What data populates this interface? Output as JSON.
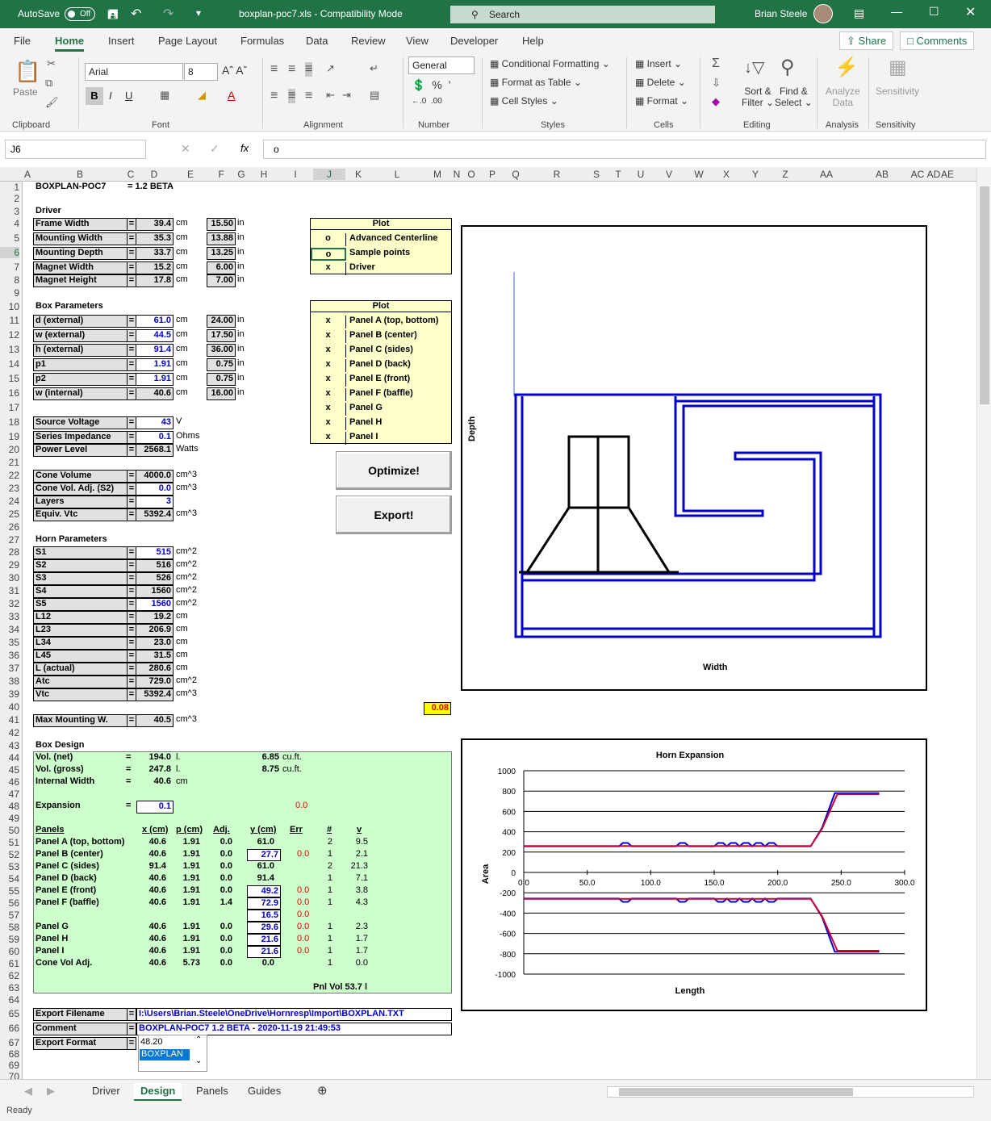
{
  "titlebar": {
    "autosave": "AutoSave",
    "toggle": "Off",
    "filename": "boxplan-poc7.xls  -  Compatibility Mode",
    "search": "Search",
    "user": "Brian Steele"
  },
  "menu": [
    "File",
    "Home",
    "Insert",
    "Page Layout",
    "Formulas",
    "Data",
    "Review",
    "View",
    "Developer",
    "Help"
  ],
  "share": "Share",
  "comments": "Comments",
  "ribbon": {
    "paste": "Paste",
    "font_name": "Arial",
    "font_size": "8",
    "number_format": "General",
    "cond_format": "Conditional Formatting",
    "format_table": "Format as Table",
    "cell_styles": "Cell Styles",
    "insert": "Insert",
    "delete": "Delete",
    "format": "Format",
    "sort1": "Sort &",
    "sort2": "Filter",
    "find1": "Find &",
    "find2": "Select",
    "analyze1": "Analyze",
    "analyze2": "Data",
    "sens": "Sensitivity",
    "groups": {
      "clipboard": "Clipboard",
      "font": "Font",
      "alignment": "Alignment",
      "number": "Number",
      "styles": "Styles",
      "cells": "Cells",
      "editing": "Editing",
      "analysis": "Analysis",
      "sensitivity": "Sensitivity"
    }
  },
  "formula": {
    "cell": "J6",
    "content": "o"
  },
  "columns": [
    "A",
    "B",
    "C",
    "D",
    "E",
    "F",
    "G",
    "H",
    "I",
    "J",
    "K",
    "L",
    "M",
    "N",
    "O",
    "P",
    "Q",
    "R",
    "S",
    "T",
    "U",
    "V",
    "W",
    "X",
    "Y",
    "Z",
    "AA",
    "AB",
    "AC",
    "AD",
    "AE"
  ],
  "sheet": {
    "title": "BOXPLAN-POC7",
    "version": "=  1.2 BETA",
    "driver_hdr": "Driver",
    "driver": [
      {
        "label": "Frame Width",
        "eq": "=",
        "val": "39.4",
        "unit": "cm",
        "in": "15.50",
        "iu": "in"
      },
      {
        "label": "Mounting Width",
        "eq": "=",
        "val": "35.3",
        "unit": "cm",
        "in": "13.88",
        "iu": "in"
      },
      {
        "label": "Mounting Depth",
        "eq": "=",
        "val": "33.7",
        "unit": "cm",
        "in": "13.25",
        "iu": "in"
      },
      {
        "label": "Magnet Width",
        "eq": "=",
        "val": "15.2",
        "unit": "cm",
        "in": "6.00",
        "iu": "in"
      },
      {
        "label": "Magnet Height",
        "eq": "=",
        "val": "17.8",
        "unit": "cm",
        "in": "7.00",
        "iu": "in"
      }
    ],
    "box_hdr": "Box Parameters",
    "box": [
      {
        "label": "d (external)",
        "eq": "=",
        "val": "61.0",
        "unit": "cm",
        "in": "24.00",
        "iu": "in"
      },
      {
        "label": "w (external)",
        "eq": "=",
        "val": "44.5",
        "unit": "cm",
        "in": "17.50",
        "iu": "in"
      },
      {
        "label": "h (external)",
        "eq": "=",
        "val": "91.4",
        "unit": "cm",
        "in": "36.00",
        "iu": "in"
      },
      {
        "label": "p1",
        "eq": "=",
        "val": "1.91",
        "unit": "cm",
        "in": "0.75",
        "iu": "in"
      },
      {
        "label": "p2",
        "eq": "=",
        "val": "1.91",
        "unit": "cm",
        "in": "0.75",
        "iu": "in"
      },
      {
        "label": "w (internal)",
        "eq": "=",
        "val": "40.6",
        "unit": "cm",
        "in": "16.00",
        "iu": "in"
      }
    ],
    "power": [
      {
        "label": "Source Voltage",
        "eq": "=",
        "val": "43",
        "unit": "V"
      },
      {
        "label": "Series Impedance",
        "eq": "=",
        "val": "0.1",
        "unit": "Ohms"
      },
      {
        "label": "Power Level",
        "eq": "=",
        "val": "2568.1",
        "unit": "Watts"
      }
    ],
    "cone": [
      {
        "label": "Cone Volume",
        "eq": "=",
        "val": "4000.0",
        "unit": "cm^3"
      },
      {
        "label": "Cone Vol. Adj. (S2)",
        "eq": "=",
        "val": "0.0",
        "unit": "cm^3"
      },
      {
        "label": "Layers",
        "eq": "=",
        "val": "3",
        "unit": ""
      },
      {
        "label": "Equiv. Vtc",
        "eq": "=",
        "val": "5392.4",
        "unit": "cm^3"
      }
    ],
    "horn_hdr": "Horn Parameters",
    "horn": [
      {
        "label": "S1",
        "eq": "=",
        "val": "515",
        "unit": "cm^2"
      },
      {
        "label": "S2",
        "eq": "=",
        "val": "516",
        "unit": "cm^2"
      },
      {
        "label": "S3",
        "eq": "=",
        "val": "526",
        "unit": "cm^2"
      },
      {
        "label": "S4",
        "eq": "=",
        "val": "1560",
        "unit": "cm^2"
      },
      {
        "label": "S5",
        "eq": "=",
        "val": "1560",
        "unit": "cm^2"
      },
      {
        "label": "L12",
        "eq": "=",
        "val": "19.2",
        "unit": "cm"
      },
      {
        "label": "L23",
        "eq": "=",
        "val": "206.9",
        "unit": "cm"
      },
      {
        "label": "L34",
        "eq": "=",
        "val": "23.0",
        "unit": "cm"
      },
      {
        "label": "L45",
        "eq": "=",
        "val": "31.5",
        "unit": "cm"
      },
      {
        "label": "L (actual)",
        "eq": "=",
        "val": "280.6",
        "unit": "cm"
      },
      {
        "label": "Atc",
        "eq": "=",
        "val": "729.0",
        "unit": "cm^2"
      },
      {
        "label": "Vtc",
        "eq": "=",
        "val": "5392.4",
        "unit": "cm^3"
      }
    ],
    "maxmount": {
      "label": "Max Mounting W.",
      "eq": "=",
      "val": "40.5",
      "unit": "cm^3"
    },
    "plot1_hdr": "Plot",
    "plot1": [
      {
        "mark": "o",
        "label": "Advanced Centerline"
      },
      {
        "mark": "o",
        "label": "Sample points"
      },
      {
        "mark": "x",
        "label": "Driver"
      }
    ],
    "plot2_hdr": "Plot",
    "plot2": [
      {
        "mark": "x",
        "label": "Panel A (top, bottom)"
      },
      {
        "mark": "x",
        "label": "Panel B (center)"
      },
      {
        "mark": "x",
        "label": "Panel C (sides)"
      },
      {
        "mark": "x",
        "label": "Panel D (back)"
      },
      {
        "mark": "x",
        "label": "Panel E (front)"
      },
      {
        "mark": "x",
        "label": "Panel F (baffle)"
      },
      {
        "mark": "x",
        "label": "Panel G"
      },
      {
        "mark": "x",
        "label": "Panel H"
      },
      {
        "mark": "x",
        "label": "Panel I"
      }
    ],
    "optimize": "Optimize!",
    "export": "Export!",
    "m40": "0.08",
    "design_hdr": "Box Design",
    "vol_net": {
      "label": "Vol. (net)",
      "eq": "=",
      "val": "194.0",
      "unit": "l.",
      "cf": "6.85",
      "cfu": "cu.ft."
    },
    "vol_gross": {
      "label": "Vol. (gross)",
      "eq": "=",
      "val": "247.8",
      "unit": "l.",
      "cf": "8.75",
      "cfu": "cu.ft."
    },
    "internal": {
      "label": "Internal Width",
      "eq": "=",
      "val": "40.6",
      "unit": "cm"
    },
    "expansion": {
      "label": "Expansion",
      "eq": "=",
      "val": "0.1",
      "err": "0.0"
    },
    "panel_cols": [
      "Panels",
      "x (cm)",
      "p (cm)",
      "Adj.",
      "y (cm)",
      "Err",
      "#",
      "v"
    ],
    "panels": [
      {
        "name": "Panel A (top, bottom)",
        "x": "40.6",
        "p": "1.91",
        "adj": "0.0",
        "y": "61.0",
        "err": "",
        "n": "2",
        "v": "9.5",
        "yin": false
      },
      {
        "name": "Panel B (center)",
        "x": "40.6",
        "p": "1.91",
        "adj": "0.0",
        "y": "27.7",
        "err": "0.0",
        "n": "1",
        "v": "2.1",
        "yin": true
      },
      {
        "name": "Panel C (sides)",
        "x": "91.4",
        "p": "1.91",
        "adj": "0.0",
        "y": "61.0",
        "err": "",
        "n": "2",
        "v": "21.3",
        "yin": false
      },
      {
        "name": "Panel D (back)",
        "x": "40.6",
        "p": "1.91",
        "adj": "0.0",
        "y": "91.4",
        "err": "",
        "n": "1",
        "v": "7.1",
        "yin": false
      },
      {
        "name": "Panel E (front)",
        "x": "40.6",
        "p": "1.91",
        "adj": "0.0",
        "y": "49.2",
        "err": "0.0",
        "n": "1",
        "v": "3.8",
        "yin": true
      },
      {
        "name": "Panel F (baffle)",
        "x": "40.6",
        "p": "1.91",
        "adj": "1.4",
        "y": "72.9",
        "err": "0.0",
        "n": "1",
        "v": "4.3",
        "yin": true
      },
      {
        "name": "",
        "x": "",
        "p": "",
        "adj": "",
        "y": "16.5",
        "err": "0.0",
        "n": "",
        "v": "",
        "yin": true
      },
      {
        "name": "Panel G",
        "x": "40.6",
        "p": "1.91",
        "adj": "0.0",
        "y": "29.6",
        "err": "0.0",
        "n": "1",
        "v": "2.3",
        "yin": true
      },
      {
        "name": "Panel H",
        "x": "40.6",
        "p": "1.91",
        "adj": "0.0",
        "y": "21.6",
        "err": "0.0",
        "n": "1",
        "v": "1.7",
        "yin": true
      },
      {
        "name": "Panel I",
        "x": "40.6",
        "p": "1.91",
        "adj": "0.0",
        "y": "21.6",
        "err": "0.0",
        "n": "1",
        "v": "1.7",
        "yin": true
      },
      {
        "name": "Cone Vol Adj.",
        "x": "40.6",
        "p": "5.73",
        "adj": "0.0",
        "y": "0.0",
        "err": "",
        "n": "1",
        "v": "0.0",
        "yin": false
      }
    ],
    "pnlvol": "Pnl Vol   53.7  l",
    "export_fn": {
      "label": "Export Filename",
      "eq": "=",
      "val": "I:\\Users\\Brian.Steele\\OneDrive\\Hornresp\\Import\\BOXPLAN.TXT"
    },
    "comment": {
      "label": "Comment",
      "eq": "=",
      "val": "BOXPLAN-POC7 1.2 BETA - 2020-11-19 21:49:53"
    },
    "export_fmt": {
      "label": "Export Format",
      "eq": "=",
      "opt1": "48.20",
      "opt2": "BOXPLAN"
    }
  },
  "chart1": {
    "xlabel": "Width",
    "ylabel": "Depth"
  },
  "chart_data": {
    "type": "line",
    "title": "Horn Expansion",
    "xlabel": "Length",
    "ylabel": "Area",
    "xlim": [
      0,
      300
    ],
    "ylim": [
      -1000,
      1000
    ],
    "xticks": [
      "0.0",
      "50.0",
      "100.0",
      "150.0",
      "200.0",
      "250.0",
      "300.0"
    ],
    "yticks": [
      "1000",
      "800",
      "600",
      "400",
      "200",
      "0",
      "-200",
      "-400",
      "-600",
      "-800",
      "-1000"
    ],
    "series": [
      {
        "color": "#0000cc",
        "x": [
          0,
          75,
          78,
          82,
          85,
          120,
          123,
          127,
          130,
          150,
          153,
          157,
          160,
          163,
          167,
          170,
          173,
          177,
          180,
          183,
          187,
          190,
          193,
          197,
          200,
          226,
          235,
          245,
          280
        ],
        "y": [
          257,
          257,
          290,
          290,
          257,
          257,
          290,
          290,
          257,
          257,
          290,
          290,
          257,
          290,
          290,
          257,
          290,
          290,
          257,
          290,
          290,
          257,
          290,
          290,
          257,
          257,
          440,
          780,
          780
        ]
      },
      {
        "color": "#cc0033",
        "x": [
          0,
          226,
          235,
          247,
          280
        ],
        "y": [
          260,
          260,
          430,
          770,
          770
        ]
      }
    ]
  },
  "tabs": [
    "Driver",
    "Design",
    "Panels",
    "Guides"
  ],
  "status": "Ready"
}
